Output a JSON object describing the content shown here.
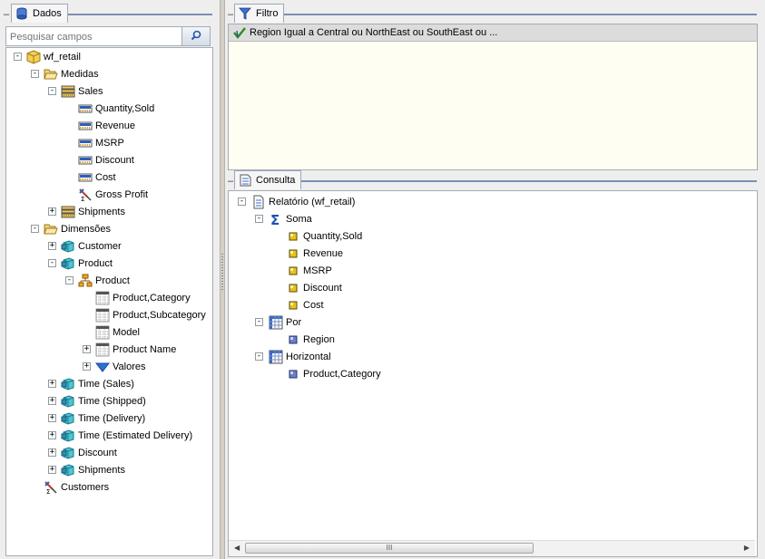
{
  "dados_panel": {
    "title": "Dados",
    "search_placeholder": "Pesquisar campos",
    "tree": [
      {
        "label": "wf_retail",
        "icon": "cube-icon",
        "exp": "-"
      },
      {
        "label": "Medidas",
        "icon": "folder-open-icon",
        "exp": "-"
      },
      {
        "label": "Sales",
        "icon": "measure-group-icon",
        "exp": "-"
      },
      {
        "label": "Quantity,Sold",
        "icon": "measure-icon",
        "exp": ""
      },
      {
        "label": "Revenue",
        "icon": "measure-icon",
        "exp": ""
      },
      {
        "label": "MSRP",
        "icon": "measure-icon",
        "exp": ""
      },
      {
        "label": "Discount",
        "icon": "measure-icon",
        "exp": ""
      },
      {
        "label": "Cost",
        "icon": "measure-icon",
        "exp": ""
      },
      {
        "label": "Gross Profit",
        "icon": "calculated-measure-icon",
        "exp": ""
      },
      {
        "label": "Shipments",
        "icon": "measure-group-icon",
        "exp": "+"
      },
      {
        "label": "Dimensões",
        "icon": "folder-open-icon",
        "exp": "-"
      },
      {
        "label": "Customer",
        "icon": "dimension-icon",
        "exp": "+"
      },
      {
        "label": "Product",
        "icon": "dimension-icon",
        "exp": "-"
      },
      {
        "label": "Product",
        "icon": "hierarchy-icon",
        "exp": "-"
      },
      {
        "label": "Product,Category",
        "icon": "level-icon",
        "exp": ""
      },
      {
        "label": "Product,Subcategory",
        "icon": "level-icon",
        "exp": ""
      },
      {
        "label": "Model",
        "icon": "level-icon",
        "exp": ""
      },
      {
        "label": "Product Name",
        "icon": "level-icon",
        "exp": "+"
      },
      {
        "label": "Valores",
        "icon": "filter-values-icon",
        "exp": "+"
      },
      {
        "label": "Time (Sales)",
        "icon": "dimension-icon",
        "exp": "+"
      },
      {
        "label": "Time (Shipped)",
        "icon": "dimension-icon",
        "exp": "+"
      },
      {
        "label": "Time (Delivery)",
        "icon": "dimension-icon",
        "exp": "+"
      },
      {
        "label": "Time (Estimated Delivery)",
        "icon": "dimension-icon",
        "exp": "+"
      },
      {
        "label": "Discount",
        "icon": "dimension-icon",
        "exp": "+"
      },
      {
        "label": "Shipments",
        "icon": "dimension-icon",
        "exp": "+"
      },
      {
        "label": "Customers",
        "icon": "calculated-measure-icon",
        "exp": ""
      }
    ]
  },
  "filtro_panel": {
    "title": "Filtro",
    "filter_text": "Region Igual a Central ou NorthEast ou SouthEast ou ..."
  },
  "consulta_panel": {
    "title": "Consulta",
    "tree": [
      {
        "label": "Relatório (wf_retail)",
        "icon": "report-icon",
        "exp": "-"
      },
      {
        "label": "Soma",
        "icon": "sigma-icon",
        "exp": "-"
      },
      {
        "label": "Quantity,Sold",
        "icon": "measure-field-icon",
        "exp": ""
      },
      {
        "label": "Revenue",
        "icon": "measure-field-icon",
        "exp": ""
      },
      {
        "label": "MSRP",
        "icon": "measure-field-icon",
        "exp": ""
      },
      {
        "label": "Discount",
        "icon": "measure-field-icon",
        "exp": ""
      },
      {
        "label": "Cost",
        "icon": "measure-field-icon",
        "exp": ""
      },
      {
        "label": "Por",
        "icon": "grid-icon",
        "exp": "-"
      },
      {
        "label": "Region",
        "icon": "dimension-field-icon",
        "exp": ""
      },
      {
        "label": "Horizontal",
        "icon": "grid-icon",
        "exp": "-"
      },
      {
        "label": "Product,Category",
        "icon": "dimension-field-icon",
        "exp": ""
      }
    ]
  },
  "scrollbar": {
    "thumb_grip": "III"
  }
}
